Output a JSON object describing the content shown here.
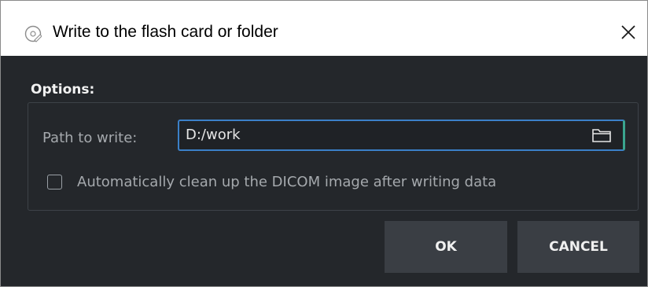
{
  "window": {
    "title": "Write to the flash card or folder",
    "icon": "disc-write-icon",
    "close_icon": "close-icon"
  },
  "options": {
    "heading": "Options:",
    "path_label": "Path to write:",
    "path_value": "D:/work",
    "browse_icon": "folder-icon",
    "auto_cleanup": {
      "label": "Automatically clean up the DICOM image after writing data",
      "checked": false
    }
  },
  "buttons": {
    "ok": "OK",
    "cancel": "CANCEL"
  },
  "colors": {
    "body_background": "#24272b",
    "field_border": "#3b80c8",
    "field_border_accent": "#3aa58f",
    "button_background": "#3a3e44"
  }
}
